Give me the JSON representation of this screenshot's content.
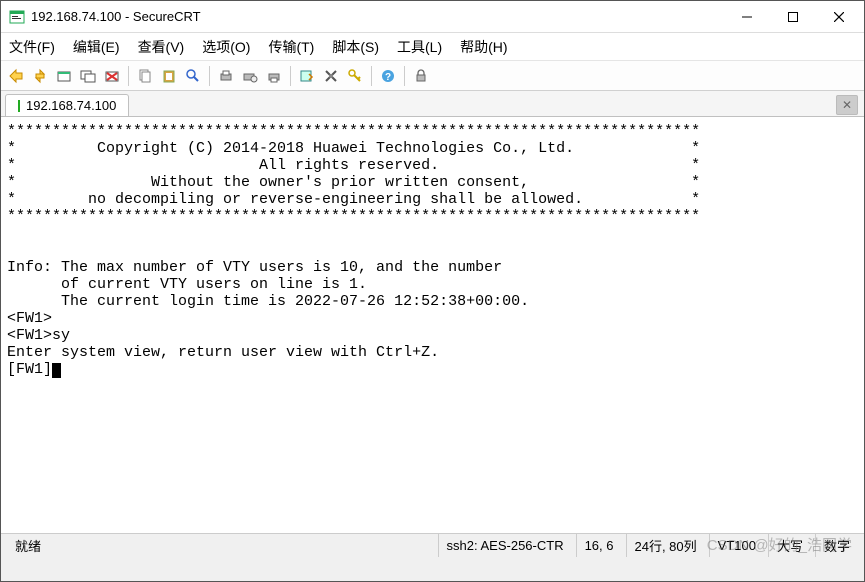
{
  "window": {
    "title": "192.168.74.100 - SecureCRT"
  },
  "menu": {
    "file": "文件(F)",
    "edit": "编辑(E)",
    "view": "查看(V)",
    "options": "选项(O)",
    "transfer": "传输(T)",
    "script": "脚本(S)",
    "tools": "工具(L)",
    "help": "帮助(H)"
  },
  "tab": {
    "label": "192.168.74.100"
  },
  "terminal": {
    "lines": [
      "*****************************************************************************",
      "*         Copyright (C) 2014-2018 Huawei Technologies Co., Ltd.             *",
      "*                           All rights reserved.                            *",
      "*               Without the owner's prior written consent,                  *",
      "*        no decompiling or reverse-engineering shall be allowed.            *",
      "*****************************************************************************",
      "",
      "",
      "Info: The max number of VTY users is 10, and the number",
      "      of current VTY users on line is 1.",
      "      The current login time is 2022-07-26 12:52:38+00:00.",
      "<FW1>",
      "<FW1>sy",
      "Enter system view, return user view with Ctrl+Z.",
      "[FW1]"
    ]
  },
  "status": {
    "ready": "就绪",
    "proto": "ssh2: AES-256-CTR",
    "pos": "16,  6",
    "size": "24行, 80列",
    "term": "VT100",
    "extra1": "大写",
    "extra2": "数字"
  },
  "watermark": "CSDN @好的_浩同学"
}
